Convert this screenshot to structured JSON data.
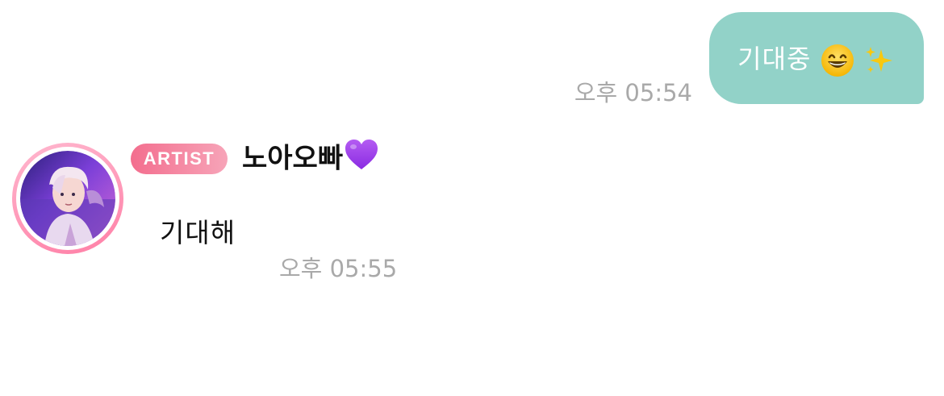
{
  "messages": {
    "outgoing": {
      "text": "기대중",
      "emoji_1": "grinning-face-icon",
      "emoji_2": "sparkles-icon",
      "time": "오후 05:54",
      "bubble_color": "#92d2c8"
    },
    "incoming": {
      "badge": "ARTIST",
      "sender": "노아오빠",
      "sender_emoji": "purple-heart-icon",
      "text": "기대해",
      "time": "오후 05:55",
      "badge_colors": [
        "#f36e8e",
        "#f7a4b8"
      ]
    }
  }
}
